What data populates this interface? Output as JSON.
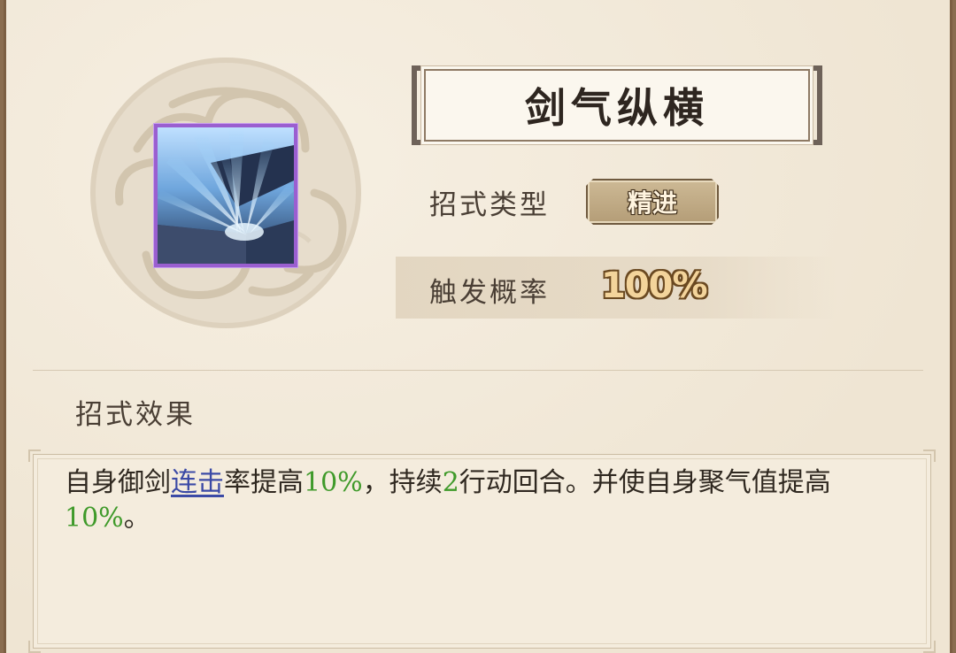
{
  "skill": {
    "name": "剑气纵横",
    "icon": "sword-aura-icon"
  },
  "info": {
    "type_label": "招式类型",
    "type_value": "精进",
    "rate_label": "触发概率",
    "rate_value": "100%"
  },
  "effect": {
    "heading": "招式效果",
    "seg1": "自身御剑",
    "link_term": "连击",
    "seg2": "率提高",
    "val1": "10%",
    "seg3": "，持续",
    "val2": "2",
    "seg4": "行动回合。并使自身聚气值提高",
    "val3": "10%",
    "seg5": "。"
  },
  "colors": {
    "panel_bg": "#f1e8d8",
    "frame": "#7c5f43",
    "highlight_green": "#3f9a2a",
    "link_blue": "#3b4aa6",
    "icon_border_purple": "#9a5fd0"
  }
}
